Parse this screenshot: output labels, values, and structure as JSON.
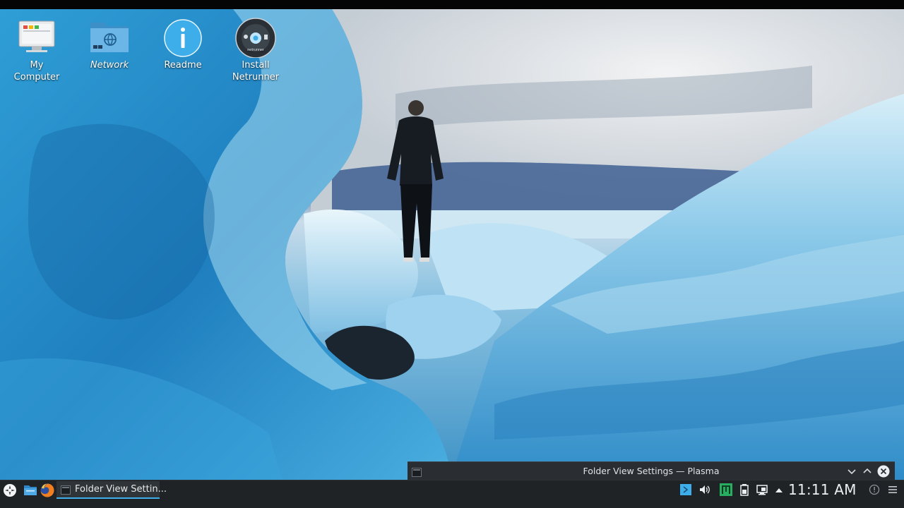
{
  "desktop": {
    "icons": [
      {
        "label_line1": "My",
        "label_line2": "Computer",
        "icon": "computer-icon"
      },
      {
        "label_line1": "Network",
        "label_line2": "",
        "icon": "network-folder-icon"
      },
      {
        "label_line1": "Readme",
        "label_line2": "",
        "icon": "info-icon"
      },
      {
        "label_line1": "Install",
        "label_line2": "Netrunner",
        "icon": "install-netrunner-icon",
        "disc_text": "netrunner"
      }
    ]
  },
  "dialog": {
    "title": "Folder View Settings — Plasma"
  },
  "taskbar": {
    "launcher_icon": "netrunner-launcher-icon",
    "pinned": [
      "file-manager-icon",
      "firefox-icon"
    ],
    "task_label": "Folder View Settin...",
    "tray_icons": [
      "blue-app-icon",
      "volume-icon",
      "green-app-icon",
      "battery-icon",
      "clipboard-icon",
      "tray-expand-icon"
    ],
    "clock": "11:11 AM",
    "accent": "#3daee9"
  }
}
